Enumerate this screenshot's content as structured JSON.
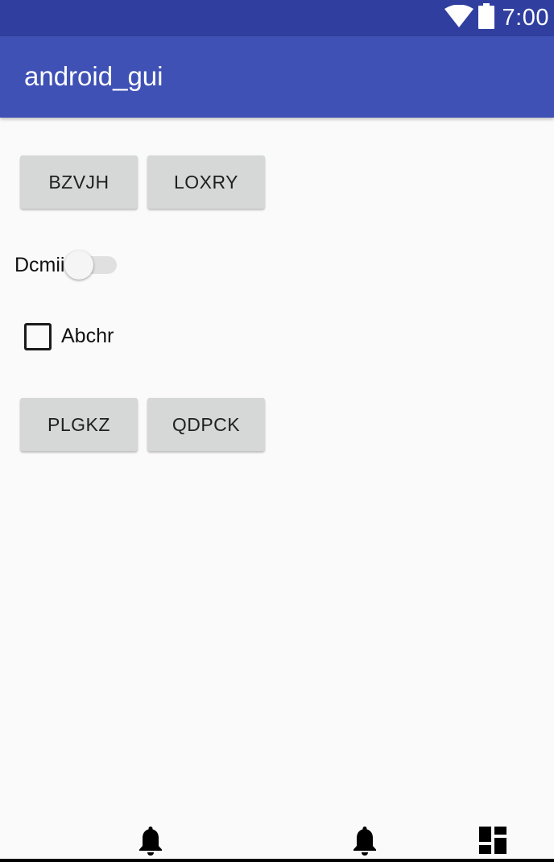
{
  "status_bar": {
    "time": "7:00",
    "icons": [
      "wifi-icon",
      "battery-icon"
    ],
    "color": "#303f9f"
  },
  "app_bar": {
    "title": "android_gui",
    "color": "#3f51b5"
  },
  "buttons": {
    "row1": [
      "BZVJH",
      "LOXRY"
    ],
    "row2": [
      "PLGKZ",
      "QDPCK"
    ]
  },
  "switch": {
    "label": "Dcmii",
    "checked": false
  },
  "checkbox": {
    "label": "Abchr",
    "checked": false
  },
  "nav_bar": {
    "icons": [
      "bell-icon",
      "bell-icon",
      "dashboard-icon"
    ]
  }
}
